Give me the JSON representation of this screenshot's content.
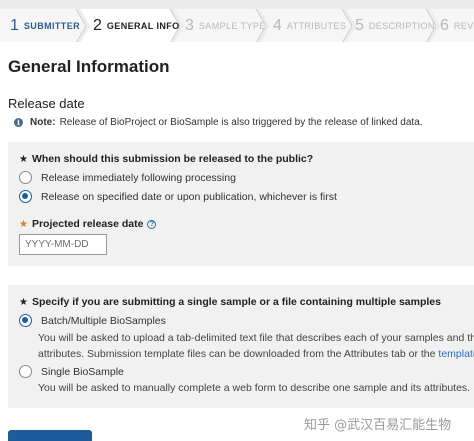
{
  "steps": [
    {
      "num": "1",
      "label": "SUBMITTER",
      "state": "done"
    },
    {
      "num": "2",
      "label": "GENERAL INFO",
      "state": "active"
    },
    {
      "num": "3",
      "label": "SAMPLE TYPE",
      "state": "todo"
    },
    {
      "num": "4",
      "label": "ATTRIBUTES",
      "state": "todo"
    },
    {
      "num": "5",
      "label": "DESCRIPTION",
      "state": "todo"
    },
    {
      "num": "6",
      "label": "REVIE",
      "state": "todo"
    }
  ],
  "page": {
    "title": "General Information",
    "release_section_title": "Release date",
    "note_label": "Note:",
    "note_text": "Release of BioProject or BioSample is also triggered by the release of linked data."
  },
  "release": {
    "question": "When should this submission be released to the public?",
    "option_immediate": "Release immediately following processing",
    "option_specified": "Release on specified date or upon publication, whichever is first",
    "selected": "specified",
    "date_label": "Projected release date",
    "date_placeholder": "YYYY-MM-DD"
  },
  "sample": {
    "question": "Specify if you are submitting a single sample or a file containing multiple samples",
    "option_batch": "Batch/Multiple BioSamples",
    "batch_desc_line1": "You will be asked to upload a tab-delimited text file that describes each of your samples and their",
    "batch_desc_line2": "attributes. Submission template files can be downloaded from the Attributes tab or the",
    "batch_desc_link": "templates p",
    "option_single": "Single BioSample",
    "single_desc": "You will be asked to manually complete a web form to describe one sample and its attributes.",
    "selected": "batch"
  },
  "watermark": "知乎 @武汉百易汇能生物",
  "colors": {
    "accent": "#1e5b9c",
    "required_star": "#e07b1f",
    "link": "#2e6cb5",
    "panel_bg": "#f1f1f1"
  }
}
